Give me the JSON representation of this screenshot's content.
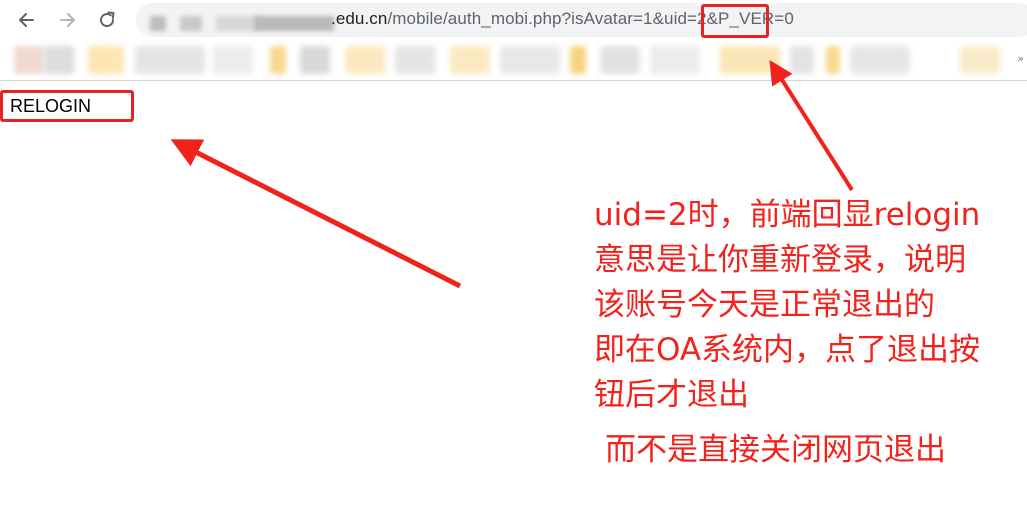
{
  "browser": {
    "url_host_suffix": ".edu.cn",
    "url_path": "/mobile/auth_mobi.php?isAvatar=1&uid=2&P_VER=0",
    "bookmarks_overflow_label": "»"
  },
  "page": {
    "body_text": "RELOGIN"
  },
  "annotation": {
    "color": "#f2231c",
    "lines": [
      "uid=2时，前端回显relogin",
      "意思是让你重新登录，说明",
      "该账号今天是正常退出的",
      "即在OA系统内，点了退出按",
      "钮后才退出"
    ],
    "extra_line": "而不是直接关闭网页退出"
  }
}
